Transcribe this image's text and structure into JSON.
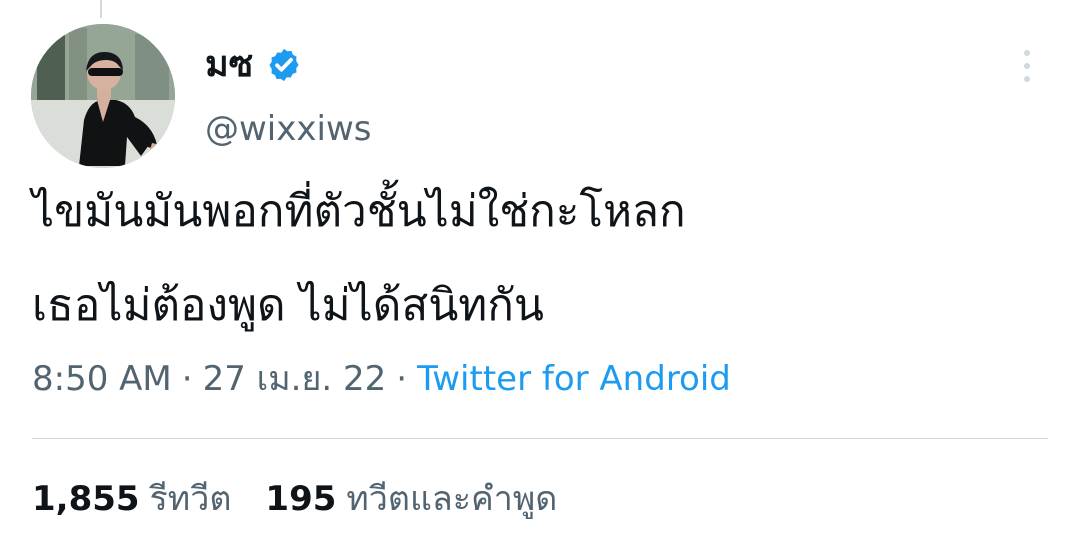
{
  "author": {
    "display_name": "มซ",
    "handle": "@wixxiws",
    "verified": true,
    "verified_color": "#1d9bf0"
  },
  "tweet": {
    "text": "ไขมันมันพอกที่ตัวชั้นไม่ใช่กะโหลก\nเธอไม่ต้องพูด ไม่ได้สนิทกัน"
  },
  "meta": {
    "time": "8:50 AM",
    "separator_1": "·",
    "date": "27 เม.ย. 22",
    "separator_2": "·",
    "source": "Twitter for Android"
  },
  "stats": {
    "retweets_count": "1,855",
    "retweets_label": "รีทวีต",
    "quotes_count": "195",
    "quotes_label": "ทวีตและคำพูด"
  },
  "icons": {
    "verified": "verified-badge-icon",
    "more": "more-options-icon"
  },
  "colors": {
    "text_primary": "#0f1419",
    "text_secondary": "#536471",
    "link": "#1d9bf0",
    "divider": "#cfd9de"
  }
}
